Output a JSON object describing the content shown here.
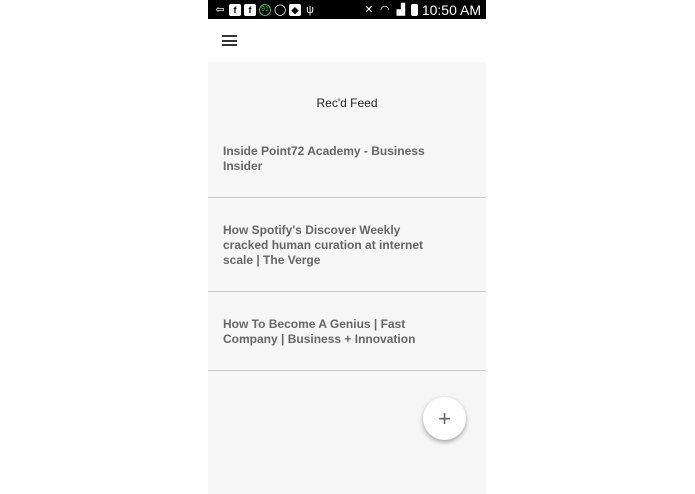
{
  "status_bar": {
    "time": "10:50 AM",
    "notification_icons": [
      "back-arrow-icon",
      "facebook-icon",
      "facebook-icon",
      "ring-91-icon",
      "whatsapp-icon",
      "shield-icon",
      "usb-icon"
    ],
    "ring_label": "91",
    "system_icons": [
      "mute-icon",
      "wifi-icon",
      "signal-icon",
      "battery-icon"
    ]
  },
  "toolbar": {
    "menu_icon": "hamburger-menu-icon"
  },
  "feed": {
    "title": "Rec'd Feed",
    "items": [
      {
        "title": "Inside Point72 Academy - Business Insider"
      },
      {
        "title": "How Spotify's Discover Weekly cracked human curation at internet scale | The Verge"
      },
      {
        "title": "How To Become A Genius | Fast Company | Business + Innovation"
      }
    ]
  },
  "fab": {
    "label": "+",
    "icon": "plus-icon"
  },
  "colors": {
    "background": "#f6f6f6",
    "status_bar": "#000000",
    "item_text": "#666666",
    "divider": "#c9c9c9"
  }
}
